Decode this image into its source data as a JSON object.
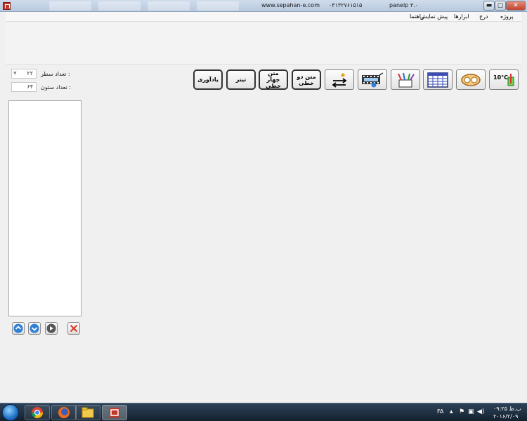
{
  "titlebar": {
    "url": "www.sepahan-e.com",
    "phone": "۰۳۱۳۲۷۶۱۵۱۵",
    "app_title": "panelp ۳.۰",
    "minimize": "▬",
    "maximize": "▢",
    "close": "✕"
  },
  "menu": {
    "items": [
      "پروژه",
      "درج",
      "ابزارها",
      "پیش نمایش",
      "راهنما"
    ]
  },
  "toolbar": {
    "btn_temperature_label": "10°C",
    "btn_two_line_text": "متن دو خطی",
    "btn_four_line_text": "متن چهار خطی",
    "btn_title": "تیتر",
    "btn_reminder": "یادآوری"
  },
  "panel": {
    "rows_label": "تعداد سطر :",
    "rows_value": "۲۲",
    "columns_label": "تعداد ستون :",
    "columns_value": "۶۴"
  },
  "taskbar": {
    "language": "FA",
    "time": "ب.ظ ۰۹:۲۵",
    "date": "۲۰۱۶/۲/۰۹"
  },
  "colors": {
    "accent_blue": "#2f7fd6",
    "close_red": "#d63a2a"
  }
}
